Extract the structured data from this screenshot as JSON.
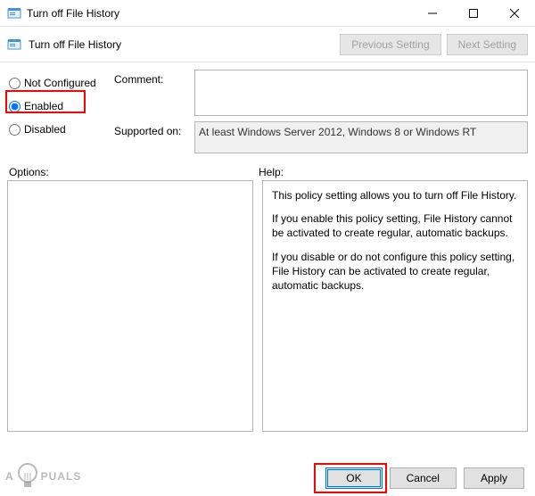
{
  "window": {
    "title": "Turn off File History"
  },
  "toolbar": {
    "title": "Turn off File History",
    "prev_setting": "Previous Setting",
    "next_setting": "Next Setting"
  },
  "radios": {
    "not_configured": "Not Configured",
    "enabled": "Enabled",
    "disabled": "Disabled",
    "selected": "enabled"
  },
  "fields": {
    "comment_label": "Comment:",
    "comment_value": "",
    "supported_label": "Supported on:",
    "supported_value": "At least Windows Server 2012, Windows 8 or Windows RT"
  },
  "panels": {
    "options_label": "Options:",
    "help_label": "Help:"
  },
  "help": {
    "p1": "This policy setting allows you to turn off File History.",
    "p2": "If you enable this policy setting, File History cannot be activated to create regular, automatic backups.",
    "p3": "If you disable or do not configure this policy setting, File History can be activated to create regular, automatic backups."
  },
  "buttons": {
    "ok": "OK",
    "cancel": "Cancel",
    "apply": "Apply"
  },
  "watermark": {
    "left": "A",
    "right": "PUALS"
  }
}
